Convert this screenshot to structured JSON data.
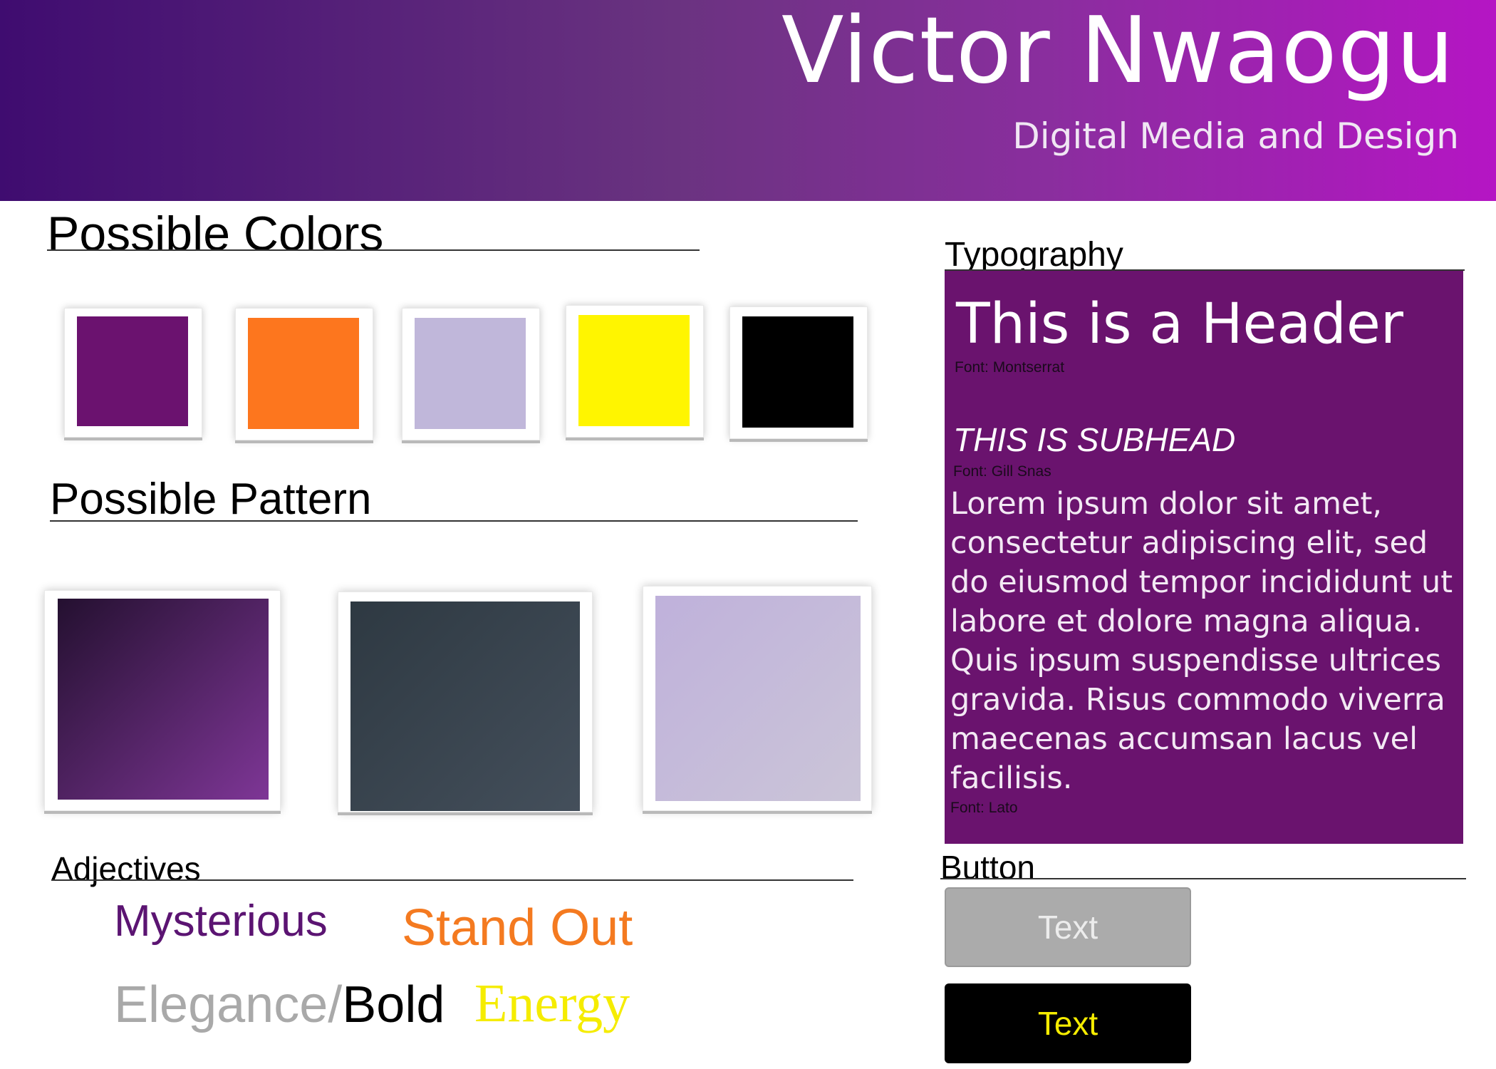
{
  "banner": {
    "name": "Victor Nwaogu",
    "subtitle": "Digital Media and Design"
  },
  "sections": {
    "colors": "Possible Colors",
    "pattern": "Possible Pattern",
    "adjectives": "Adjectives",
    "typography": "Typography",
    "button": "Button"
  },
  "colors": [
    "#6b126f",
    "#fd761e",
    "#c0b7da",
    "#fff500",
    "#000000"
  ],
  "patterns": [
    {
      "from": "#241030",
      "to": "#7e3696"
    },
    {
      "from": "#2e3942",
      "to": "#444f5b"
    },
    {
      "from": "#bfb1db",
      "to": "#cbc5d8"
    }
  ],
  "typography": {
    "header": "This is a Header",
    "header_font": "Font: Montserrat",
    "subhead": "THIS IS SUBHEAD",
    "subhead_font": "Font: Gill Snas",
    "body": "Lorem ipsum dolor sit amet, consectetur adipiscing elit, sed do eiusmod tempor incididunt ut labore et dolore magna aliqua. Quis ipsum suspendisse ultrices gravida. Risus commodo viverra maecenas accumsan lacus vel facilisis.",
    "body_font": "Font: Lato",
    "panel_color": "#6a136e"
  },
  "adjectives": {
    "mysterious": "Mysterious",
    "stand_out": "Stand Out",
    "elegance": "Elegance/",
    "bold": "Bold",
    "energy": "Energy"
  },
  "buttons": {
    "gray_label": "Text",
    "black_label": "Text"
  }
}
